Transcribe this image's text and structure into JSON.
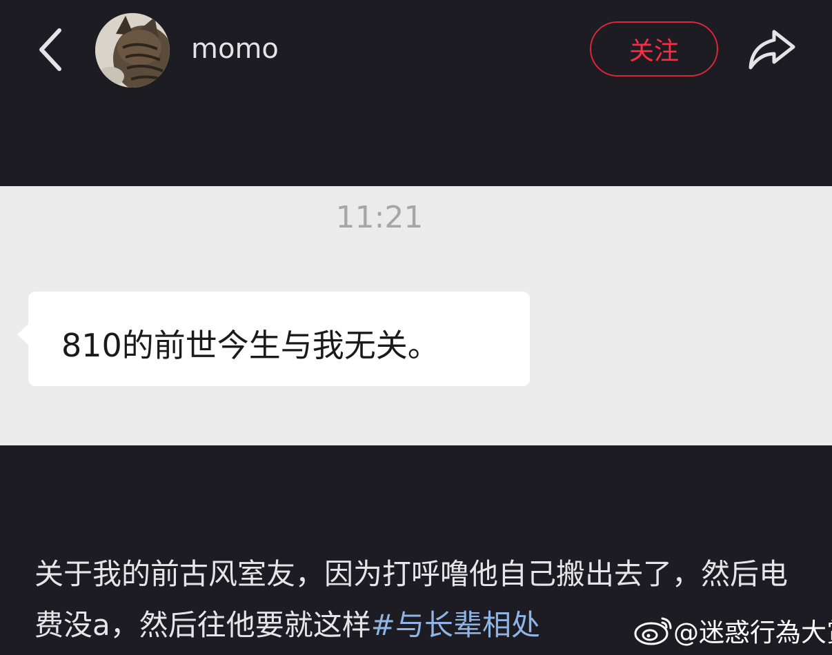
{
  "header": {
    "back_icon": "chevron-left-icon",
    "username": "momo",
    "follow_label": "关注",
    "share_icon": "share-arrow-icon",
    "accent_color": "#ff2b44"
  },
  "screenshot": {
    "time": "11:21",
    "message": "810的前世今生与我无关。"
  },
  "post": {
    "text": "关于我的前古风室友，因为打呼噜他自己搬出去了，然后电费没a，然后往他要就这样",
    "hashtag": "#与长辈相处"
  },
  "watermark": {
    "icon": "weibo-logo-icon",
    "text": "@迷惑行為大賞"
  }
}
